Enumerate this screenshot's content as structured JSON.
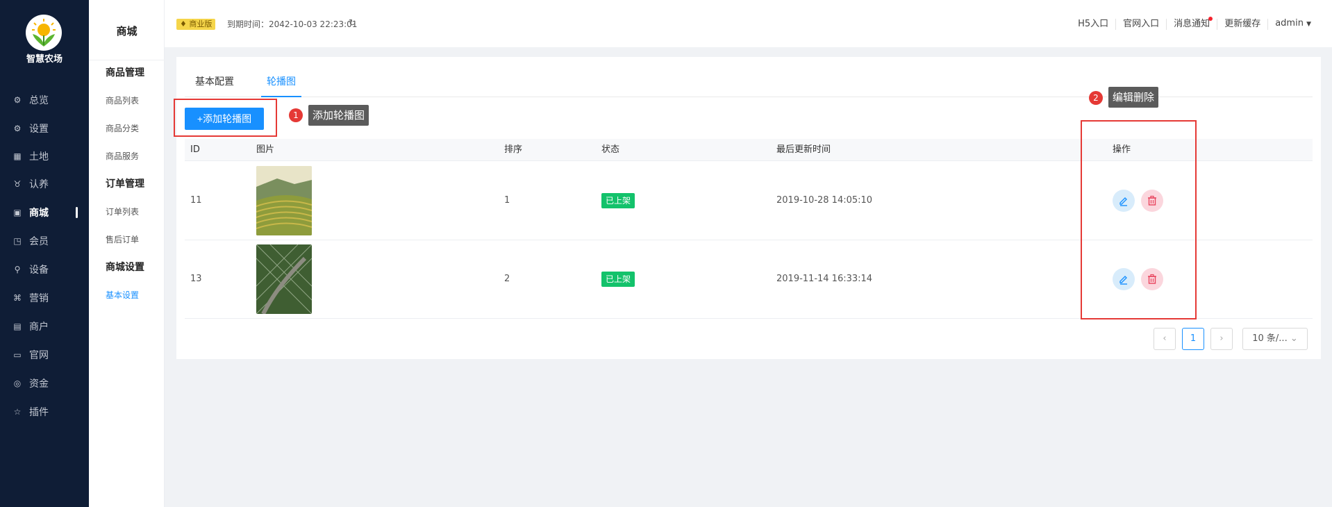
{
  "sidebar": {
    "logo_name": "智慧农场",
    "items": [
      {
        "label": "总览",
        "icon": "dashboard-icon",
        "glyph": "⚙"
      },
      {
        "label": "设置",
        "icon": "gear-icon",
        "glyph": "⚙"
      },
      {
        "label": "土地",
        "icon": "grid-icon",
        "glyph": "▦"
      },
      {
        "label": "认养",
        "icon": "cow-icon",
        "glyph": "♉"
      },
      {
        "label": "商城",
        "icon": "shop-icon",
        "glyph": "▣"
      },
      {
        "label": "会员",
        "icon": "member-icon",
        "glyph": "◳"
      },
      {
        "label": "设备",
        "icon": "device-icon",
        "glyph": "⚲"
      },
      {
        "label": "营销",
        "icon": "marketing-icon",
        "glyph": "⌘"
      },
      {
        "label": "商户",
        "icon": "merchant-icon",
        "glyph": "▤"
      },
      {
        "label": "官网",
        "icon": "website-icon",
        "glyph": "▭"
      },
      {
        "label": "资金",
        "icon": "money-icon",
        "glyph": "◎"
      },
      {
        "label": "插件",
        "icon": "plugin-icon",
        "glyph": "☆"
      }
    ]
  },
  "subside": {
    "title": "商城",
    "groups": [
      {
        "label": "商品管理"
      },
      {
        "label": "订单管理"
      },
      {
        "label": "商城设置"
      }
    ],
    "links": [
      {
        "label": "商品列表"
      },
      {
        "label": "商品分类"
      },
      {
        "label": "商品服务"
      },
      {
        "label": "订单列表"
      },
      {
        "label": "售后订单"
      },
      {
        "label": "基本设置"
      }
    ]
  },
  "header": {
    "edition_badge": "商业版",
    "expire": "到期时间：2042-10-03 22:23:01",
    "links": [
      "H5入口",
      "官网入口",
      "消息通知",
      "更新缓存",
      "admin"
    ]
  },
  "tabs": [
    "基本配置",
    "轮播图"
  ],
  "add_button": "+添加轮播图",
  "annotations": [
    {
      "num": "1",
      "text": "添加轮播图"
    },
    {
      "num": "2",
      "text": "编辑删除"
    }
  ],
  "table": {
    "headers": [
      "ID",
      "图片",
      "排序",
      "状态",
      "最后更新时间",
      "操作"
    ],
    "rows": [
      {
        "id": "11",
        "sort": "1",
        "status": "已上架",
        "updated": "2019-10-28 14:05:10"
      },
      {
        "id": "13",
        "sort": "2",
        "status": "已上架",
        "updated": "2019-11-14 16:33:14"
      }
    ]
  },
  "pagination": {
    "current": "1",
    "page_size": "10 条/..."
  },
  "colors": {
    "primary": "#1890ff",
    "sidebar_bg": "#0f1d36",
    "status_green": "#13c26b",
    "annotation_red": "#e53935"
  }
}
